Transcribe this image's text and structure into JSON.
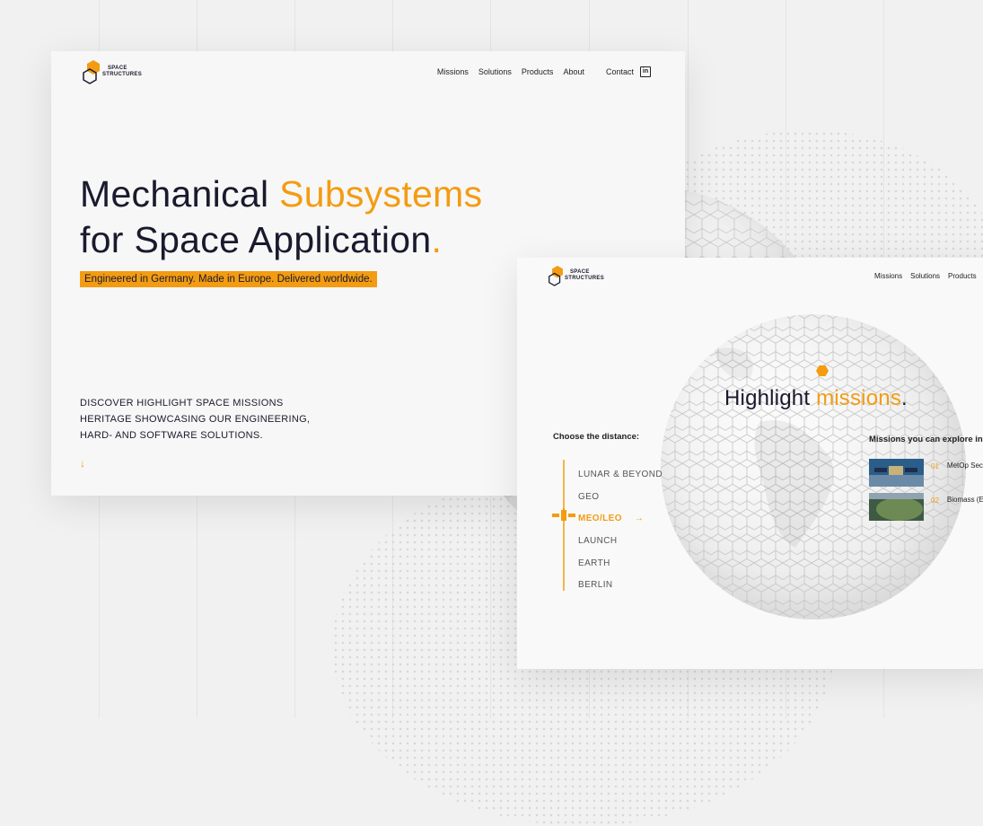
{
  "hero_page": {
    "logo": {
      "line1": "SPACE",
      "line2": "STRUCTURES"
    },
    "nav": [
      {
        "label": "Missions"
      },
      {
        "label": "Solutions"
      },
      {
        "label": "Products"
      },
      {
        "label": "About"
      }
    ],
    "contact_label": "Contact",
    "linkedin_glyph": "in",
    "title_line1_a": "Mechanical ",
    "title_line1_b": "Subsystems",
    "title_line2_a": "for Space Application",
    "title_line2_b": ".",
    "tagline": "Engineered in Germany. Made in Europe. Delivered worldwide.",
    "discover_lines": [
      "DISCOVER HIGHLIGHT SPACE MISSIONS",
      "HERITAGE SHOWCASING OUR ENGINEERING,",
      "HARD- AND SOFTWARE SOLUTIONS."
    ],
    "scroll_arrow": "↓"
  },
  "missions_page": {
    "logo": {
      "line1": "SPACE",
      "line2": "STRUCTURES"
    },
    "nav": [
      {
        "label": "Missions"
      },
      {
        "label": "Solutions"
      },
      {
        "label": "Products"
      }
    ],
    "title_a": "Highlight ",
    "title_b": "missions",
    "title_c": ".",
    "choose_label": "Choose the distance:",
    "distances": [
      {
        "label": "LUNAR & BEYOND",
        "active": false
      },
      {
        "label": "GEO",
        "active": false
      },
      {
        "label": "MEO/LEO",
        "active": true
      },
      {
        "label": "LAUNCH",
        "active": false
      },
      {
        "label": "EARTH",
        "active": false
      },
      {
        "label": "BERLIN",
        "active": false
      }
    ],
    "active_arrow": "→",
    "explore_label": "Missions you can explore in",
    "missions": [
      {
        "num": "01",
        "name": "MetOp Sec SG)"
      },
      {
        "num": "02",
        "name": "Biomass (E"
      }
    ]
  },
  "colors": {
    "accent": "#f39c12",
    "text": "#1a1a2e",
    "background": "#f1f1f1"
  }
}
